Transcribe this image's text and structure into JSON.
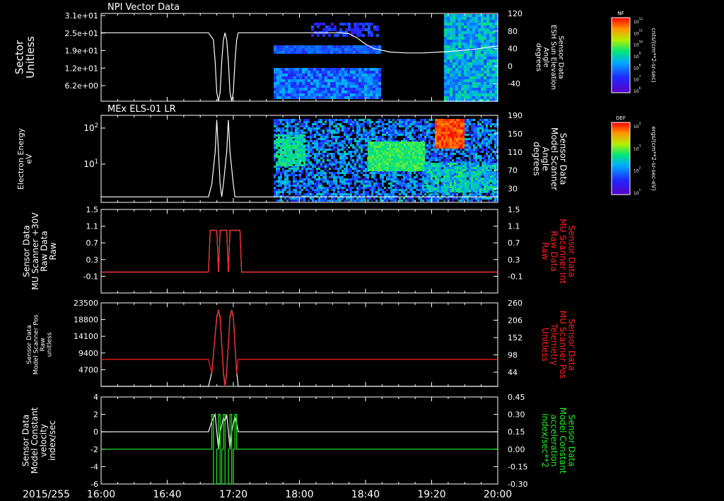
{
  "date_label": "2015/255",
  "x_ticks": [
    "16:00",
    "16:40",
    "17:20",
    "18:00",
    "18:40",
    "19:20",
    "20:00"
  ],
  "colors": {
    "white": "#ffffff",
    "red": "#ff2020",
    "green": "#22ee22",
    "background": "#000000"
  },
  "chart_data": [
    {
      "type": "heatmap",
      "title": "NPI Vector Data",
      "ylabel": "Sector\nUnitless",
      "y_ticks": [
        "3.1e+01",
        "2.5e+01",
        "1.9e+01",
        "1.2e+01",
        "6.2e+00"
      ],
      "y2label": "Sensor Data\nESH Sun Elevation\nAngle\ndegrees",
      "y2_ticks": [
        "120",
        "80",
        "40",
        "0",
        "-40"
      ],
      "y2lim": [
        -80,
        120
      ],
      "colorbar": {
        "label": "NF",
        "units": "cnts/(cm**2-sr-sec)",
        "ticks": [
          "10^12",
          "10^11",
          "10^10",
          "10^9",
          "10^8",
          "10^7",
          "10^6"
        ]
      },
      "line_series": [
        {
          "color": "white",
          "axis": "right",
          "points": [
            [
              "16:00",
              76
            ],
            [
              "17:05",
              76
            ],
            [
              "17:08",
              60
            ],
            [
              "17:09",
              10
            ],
            [
              "17:10",
              -60
            ],
            [
              "17:11",
              -80
            ],
            [
              "17:12",
              -60
            ],
            [
              "17:13",
              10
            ],
            [
              "17:14",
              60
            ],
            [
              "17:15",
              76
            ],
            [
              "17:16",
              60
            ],
            [
              "17:17",
              10
            ],
            [
              "17:18",
              -60
            ],
            [
              "17:19",
              -80
            ],
            [
              "17:20",
              -60
            ],
            [
              "17:21",
              10
            ],
            [
              "17:22",
              60
            ],
            [
              "17:23",
              76
            ],
            [
              "18:25",
              76
            ],
            [
              "18:30",
              74
            ],
            [
              "18:35",
              64
            ],
            [
              "18:40",
              50
            ],
            [
              "18:45",
              40
            ],
            [
              "18:55",
              32
            ],
            [
              "19:05",
              30
            ],
            [
              "19:15",
              30
            ],
            [
              "19:30",
              33
            ],
            [
              "19:45",
              38
            ],
            [
              "20:00",
              46
            ]
          ]
        }
      ]
    },
    {
      "type": "heatmap",
      "title": "MEx ELS-01 LR",
      "ylabel": "Electron Energy\neV",
      "y_ticks": [
        "10^2",
        "10^1"
      ],
      "y2label": "Sensor Data\nModel Scanner\nAngle\ndegrees",
      "y2_ticks": [
        "190",
        "150",
        "110",
        "70",
        "30"
      ],
      "y2lim": [
        0,
        190
      ],
      "colorbar": {
        "label": "DEF",
        "units": "ergs/(cm**2-sr-sec-eV)",
        "ticks": [
          "10^4",
          "10^3",
          "10^2",
          "10^1"
        ]
      },
      "line_series": [
        {
          "color": "white",
          "axis": "right",
          "points": [
            [
              "16:00",
              12
            ],
            [
              "17:05",
              12
            ],
            [
              "17:07",
              40
            ],
            [
              "17:09",
              110
            ],
            [
              "17:10",
              180
            ],
            [
              "17:11",
              110
            ],
            [
              "17:12",
              40
            ],
            [
              "17:13",
              12
            ],
            [
              "17:14",
              40
            ],
            [
              "17:16",
              110
            ],
            [
              "17:17",
              180
            ],
            [
              "17:18",
              110
            ],
            [
              "17:20",
              40
            ],
            [
              "17:21",
              12
            ],
            [
              "20:00",
              12
            ]
          ]
        }
      ]
    },
    {
      "type": "line",
      "ylabel": "Sensor Data\nMU Scanner +30V\nRaw Data\nRaw",
      "y_ticks": [
        "1.5",
        "1.1",
        "0.7",
        "0.3",
        "-0.1"
      ],
      "ylim": [
        -0.5,
        1.5
      ],
      "y2label": "Sensor Data\nMU Scanner Int\nRaw Data\nRaw",
      "y2_ticks": [
        "1.5",
        "1.1",
        "0.7",
        "0.3",
        "-0.1"
      ],
      "y2lim": [
        -0.5,
        1.5
      ],
      "series": [
        {
          "color": "white",
          "axis": "left",
          "points": [
            [
              "16:00",
              0
            ],
            [
              "17:05",
              0
            ],
            [
              "17:06",
              1
            ],
            [
              "17:10",
              1
            ],
            [
              "17:11",
              0
            ],
            [
              "17:12",
              1
            ],
            [
              "17:16",
              1
            ],
            [
              "17:17",
              0
            ],
            [
              "17:18",
              1
            ],
            [
              "17:24",
              1
            ],
            [
              "17:25",
              0
            ],
            [
              "20:00",
              0
            ]
          ]
        },
        {
          "color": "red",
          "axis": "right",
          "points": [
            [
              "16:00",
              0
            ],
            [
              "17:05",
              0
            ],
            [
              "17:06",
              1
            ],
            [
              "17:10",
              1
            ],
            [
              "17:11",
              0
            ],
            [
              "17:12",
              1
            ],
            [
              "17:16",
              1
            ],
            [
              "17:17",
              0
            ],
            [
              "17:18",
              1
            ],
            [
              "17:24",
              1
            ],
            [
              "17:25",
              0
            ],
            [
              "20:00",
              0
            ]
          ]
        }
      ]
    },
    {
      "type": "line",
      "ylabel": "Sensor Data\nModel Scanner Pos\nRaw\nunitless",
      "y_ticks": [
        "23500",
        "18800",
        "14100",
        "9400",
        "4700"
      ],
      "ylim": [
        0,
        23500
      ],
      "y2label": "Sensor Data\nMU Scanner Pos\nTelemetry\nUnitless",
      "y2_ticks": [
        "260",
        "206",
        "152",
        "98",
        "44"
      ],
      "y2lim": [
        0,
        260
      ],
      "series": [
        {
          "color": "white",
          "axis": "left",
          "points": [
            [
              "16:00",
              0
            ],
            [
              "17:05",
              0
            ],
            [
              "17:07",
              4000
            ],
            [
              "17:10",
              19500
            ],
            [
              "17:11",
              21500
            ],
            [
              "17:12",
              19500
            ],
            [
              "17:14",
              4000
            ],
            [
              "17:15",
              0
            ],
            [
              "17:16",
              4000
            ],
            [
              "17:18",
              19500
            ],
            [
              "17:19",
              21500
            ],
            [
              "17:20",
              19500
            ],
            [
              "17:22",
              4000
            ],
            [
              "17:23",
              0
            ],
            [
              "20:00",
              0
            ]
          ]
        },
        {
          "color": "red",
          "axis": "right",
          "points": [
            [
              "16:00",
              84
            ],
            [
              "17:05",
              84
            ],
            [
              "17:07",
              40
            ],
            [
              "17:10",
              220
            ],
            [
              "17:11",
              236
            ],
            [
              "17:12",
              220
            ],
            [
              "17:14",
              40
            ],
            [
              "17:15",
              0
            ],
            [
              "17:16",
              40
            ],
            [
              "17:18",
              220
            ],
            [
              "17:19",
              236
            ],
            [
              "17:20",
              220
            ],
            [
              "17:22",
              40
            ],
            [
              "17:23",
              84
            ],
            [
              "20:00",
              84
            ]
          ]
        }
      ]
    },
    {
      "type": "line",
      "ylabel": "Sensor Data\nModel Constant\nvelocity\nindex/sec",
      "y_ticks": [
        "4",
        "2",
        "0",
        "-2",
        "-4",
        "-6"
      ],
      "ylim": [
        -6,
        4
      ],
      "y2label": "Sensor Data\nModel Constant\nacceleration\nindex/sec**2",
      "y2_ticks": [
        "0.45",
        "0.30",
        "0.15",
        "0.00",
        "-0.15",
        "-0.30"
      ],
      "y2lim": [
        -0.3,
        0.45
      ],
      "series": [
        {
          "color": "white",
          "axis": "left",
          "points": [
            [
              "16:00",
              0
            ],
            [
              "17:05",
              0
            ],
            [
              "17:07",
              1.2
            ],
            [
              "17:09",
              2
            ],
            [
              "17:10",
              0
            ],
            [
              "17:11",
              -2
            ],
            [
              "17:12",
              0
            ],
            [
              "17:14",
              1.6
            ],
            [
              "17:15",
              1.2
            ],
            [
              "17:16",
              2
            ],
            [
              "17:17",
              0
            ],
            [
              "17:18",
              -2
            ],
            [
              "17:19",
              0
            ],
            [
              "17:21",
              1.8
            ],
            [
              "17:22",
              1
            ],
            [
              "17:23",
              0
            ],
            [
              "20:00",
              0
            ]
          ]
        },
        {
          "color": "green",
          "axis": "right",
          "points": [
            [
              "16:00",
              0
            ],
            [
              "17:07",
              0
            ],
            [
              "17:07",
              0.3
            ],
            [
              "17:08",
              0.3
            ],
            [
              "17:08",
              -0.3
            ],
            [
              "17:10",
              -0.3
            ],
            [
              "17:10",
              0
            ],
            [
              "17:11",
              0
            ],
            [
              "17:11",
              0.3
            ],
            [
              "17:12",
              0.3
            ],
            [
              "17:12",
              -0.3
            ],
            [
              "17:13",
              -0.3
            ],
            [
              "17:13",
              0
            ],
            [
              "17:14",
              0
            ],
            [
              "17:14",
              0.3
            ],
            [
              "17:15",
              0.3
            ],
            [
              "17:15",
              -0.3
            ],
            [
              "17:17",
              -0.3
            ],
            [
              "17:17",
              0
            ],
            [
              "17:18",
              0
            ],
            [
              "17:18",
              0.3
            ],
            [
              "17:19",
              0.3
            ],
            [
              "17:19",
              -0.3
            ],
            [
              "17:20",
              -0.3
            ],
            [
              "17:20",
              0
            ],
            [
              "17:21",
              0
            ],
            [
              "17:21",
              0.3
            ],
            [
              "17:22",
              0.3
            ],
            [
              "17:22",
              0
            ],
            [
              "20:00",
              0
            ]
          ]
        }
      ]
    }
  ]
}
